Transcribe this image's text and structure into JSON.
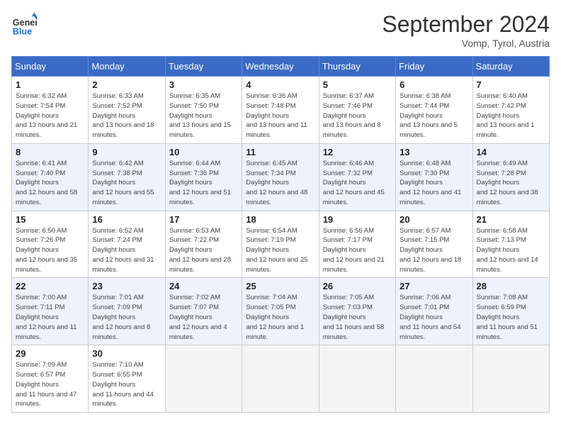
{
  "header": {
    "logo_line1": "General",
    "logo_line2": "Blue",
    "month": "September 2024",
    "location": "Vomp, Tyrol, Austria"
  },
  "days_of_week": [
    "Sunday",
    "Monday",
    "Tuesday",
    "Wednesday",
    "Thursday",
    "Friday",
    "Saturday"
  ],
  "weeks": [
    [
      {
        "num": "1",
        "rise": "6:32 AM",
        "set": "7:54 PM",
        "daylight": "13 hours and 21 minutes."
      },
      {
        "num": "2",
        "rise": "6:33 AM",
        "set": "7:52 PM",
        "daylight": "13 hours and 18 minutes."
      },
      {
        "num": "3",
        "rise": "6:35 AM",
        "set": "7:50 PM",
        "daylight": "13 hours and 15 minutes."
      },
      {
        "num": "4",
        "rise": "6:36 AM",
        "set": "7:48 PM",
        "daylight": "13 hours and 11 minutes."
      },
      {
        "num": "5",
        "rise": "6:37 AM",
        "set": "7:46 PM",
        "daylight": "13 hours and 8 minutes."
      },
      {
        "num": "6",
        "rise": "6:38 AM",
        "set": "7:44 PM",
        "daylight": "13 hours and 5 minutes."
      },
      {
        "num": "7",
        "rise": "6:40 AM",
        "set": "7:42 PM",
        "daylight": "13 hours and 1 minute."
      }
    ],
    [
      {
        "num": "8",
        "rise": "6:41 AM",
        "set": "7:40 PM",
        "daylight": "12 hours and 58 minutes."
      },
      {
        "num": "9",
        "rise": "6:42 AM",
        "set": "7:38 PM",
        "daylight": "12 hours and 55 minutes."
      },
      {
        "num": "10",
        "rise": "6:44 AM",
        "set": "7:36 PM",
        "daylight": "12 hours and 51 minutes."
      },
      {
        "num": "11",
        "rise": "6:45 AM",
        "set": "7:34 PM",
        "daylight": "12 hours and 48 minutes."
      },
      {
        "num": "12",
        "rise": "6:46 AM",
        "set": "7:32 PM",
        "daylight": "12 hours and 45 minutes."
      },
      {
        "num": "13",
        "rise": "6:48 AM",
        "set": "7:30 PM",
        "daylight": "12 hours and 41 minutes."
      },
      {
        "num": "14",
        "rise": "6:49 AM",
        "set": "7:28 PM",
        "daylight": "12 hours and 38 minutes."
      }
    ],
    [
      {
        "num": "15",
        "rise": "6:50 AM",
        "set": "7:26 PM",
        "daylight": "12 hours and 35 minutes."
      },
      {
        "num": "16",
        "rise": "6:52 AM",
        "set": "7:24 PM",
        "daylight": "12 hours and 31 minutes."
      },
      {
        "num": "17",
        "rise": "6:53 AM",
        "set": "7:22 PM",
        "daylight": "12 hours and 28 minutes."
      },
      {
        "num": "18",
        "rise": "6:54 AM",
        "set": "7:19 PM",
        "daylight": "12 hours and 25 minutes."
      },
      {
        "num": "19",
        "rise": "6:56 AM",
        "set": "7:17 PM",
        "daylight": "12 hours and 21 minutes."
      },
      {
        "num": "20",
        "rise": "6:57 AM",
        "set": "7:15 PM",
        "daylight": "12 hours and 18 minutes."
      },
      {
        "num": "21",
        "rise": "6:58 AM",
        "set": "7:13 PM",
        "daylight": "12 hours and 14 minutes."
      }
    ],
    [
      {
        "num": "22",
        "rise": "7:00 AM",
        "set": "7:11 PM",
        "daylight": "12 hours and 11 minutes."
      },
      {
        "num": "23",
        "rise": "7:01 AM",
        "set": "7:09 PM",
        "daylight": "12 hours and 8 minutes."
      },
      {
        "num": "24",
        "rise": "7:02 AM",
        "set": "7:07 PM",
        "daylight": "12 hours and 4 minutes."
      },
      {
        "num": "25",
        "rise": "7:04 AM",
        "set": "7:05 PM",
        "daylight": "12 hours and 1 minute."
      },
      {
        "num": "26",
        "rise": "7:05 AM",
        "set": "7:03 PM",
        "daylight": "11 hours and 58 minutes."
      },
      {
        "num": "27",
        "rise": "7:06 AM",
        "set": "7:01 PM",
        "daylight": "11 hours and 54 minutes."
      },
      {
        "num": "28",
        "rise": "7:08 AM",
        "set": "6:59 PM",
        "daylight": "11 hours and 51 minutes."
      }
    ],
    [
      {
        "num": "29",
        "rise": "7:09 AM",
        "set": "6:57 PM",
        "daylight": "11 hours and 47 minutes."
      },
      {
        "num": "30",
        "rise": "7:10 AM",
        "set": "6:55 PM",
        "daylight": "11 hours and 44 minutes."
      },
      null,
      null,
      null,
      null,
      null
    ]
  ]
}
